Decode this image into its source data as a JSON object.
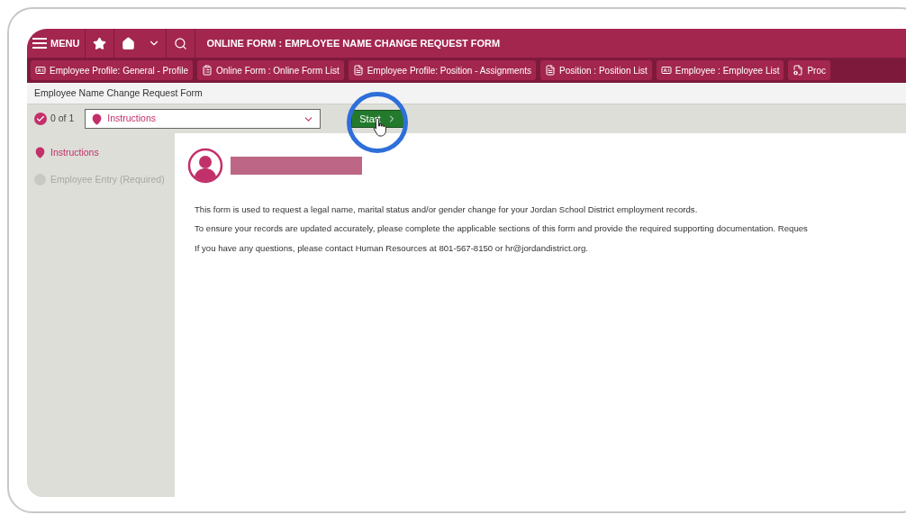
{
  "header": {
    "menu_label": "MENU",
    "title": "ONLINE FORM : EMPLOYEE NAME CHANGE REQUEST FORM"
  },
  "tabs": [
    {
      "label": "Employee Profile: General - Profile",
      "kind": "card"
    },
    {
      "label": "Online Form : Online Form List",
      "kind": "list"
    },
    {
      "label": "Employee Profile: Position - Assignments",
      "kind": "doc"
    },
    {
      "label": "Position : Position List",
      "kind": "doc"
    },
    {
      "label": "Employee : Employee List",
      "kind": "card"
    },
    {
      "label": "Proc",
      "kind": "gear"
    }
  ],
  "breadcrumb": "Employee Name Change Request Form",
  "toolbar": {
    "progress": "0 of 1",
    "step_select": "Instructions",
    "start_button": "Start"
  },
  "steps": [
    {
      "label": "Instructions",
      "selected": true
    },
    {
      "label": "Employee Entry (Required)",
      "selected": false
    }
  ],
  "paragraphs": [
    "This form is used to request a legal name, marital status and/or gender change for your Jordan School District employment records.",
    "To ensure your records are updated accurately, please complete the applicable sections of this form and provide the required supporting documentation. Reques",
    "If you have any questions, please contact Human Resources at 801-567-8150 or hr@jordandistrict.org."
  ]
}
